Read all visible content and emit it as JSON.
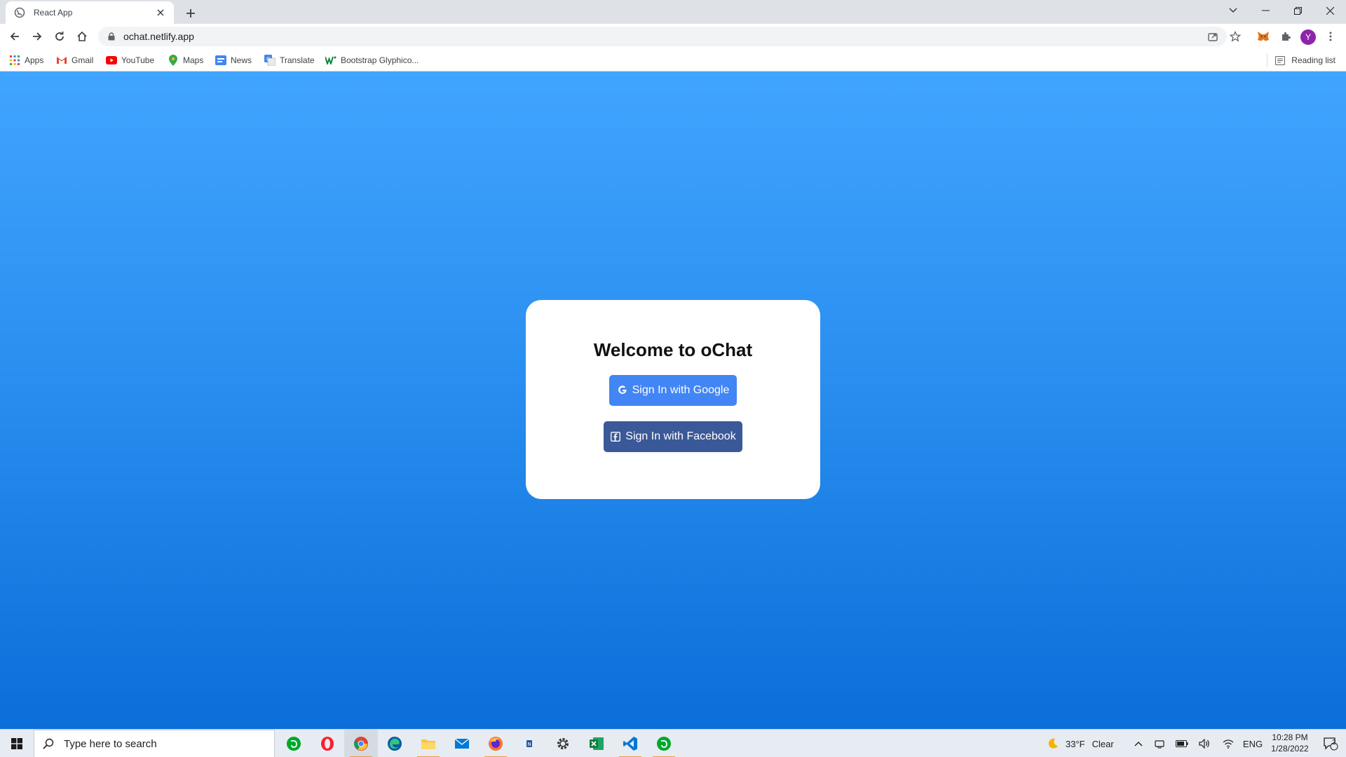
{
  "browser": {
    "tab": {
      "title": "React App"
    },
    "url": "ochat.netlify.app",
    "avatar_letter": "Y",
    "bookmarks": [
      {
        "label": "Apps",
        "icon": "apps-grid-icon"
      },
      {
        "label": "Gmail",
        "icon": "gmail-icon"
      },
      {
        "label": "YouTube",
        "icon": "youtube-icon"
      },
      {
        "label": "Maps",
        "icon": "maps-icon"
      },
      {
        "label": "News",
        "icon": "news-icon"
      },
      {
        "label": "Translate",
        "icon": "translate-icon"
      },
      {
        "label": "Bootstrap Glyphico...",
        "icon": "bootstrap-w-icon"
      }
    ],
    "reading_list": "Reading list"
  },
  "page": {
    "heading": "Welcome to oChat",
    "google_button": "Sign In with Google",
    "facebook_button": "Sign In with Facebook",
    "background_top": "#40a5fe",
    "background_bottom": "#0b6ed9"
  },
  "taskbar": {
    "search_placeholder": "Type here to search",
    "weather_temp": "33°F",
    "weather_desc": "Clear",
    "language": "ENG",
    "time": "10:28 PM",
    "date": "1/28/2022",
    "notification_count": "2",
    "apps": [
      "evernote-icon",
      "opera-icon",
      "chrome-icon",
      "edge-icon",
      "file-explorer-icon",
      "mail-icon",
      "firefox-icon",
      "app-icon",
      "settings-icon",
      "excel-icon",
      "vscode-icon",
      "evernote-icon"
    ]
  }
}
